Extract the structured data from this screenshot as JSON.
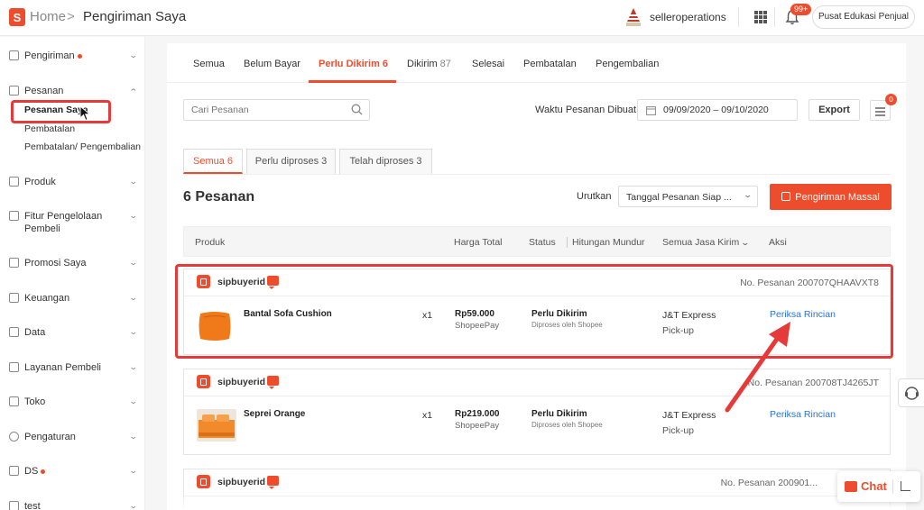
{
  "header": {
    "logo_letter": "S",
    "home_label": "Home",
    "separator": ">",
    "page_title": "Pengiriman Saya",
    "username": "selleroperations",
    "notification_badge": "99+",
    "edu_button": "Pusat Edukasi Penjual"
  },
  "sidebar": {
    "items": [
      {
        "label": "Pengiriman",
        "icon": "truck-icon",
        "dot": true
      },
      {
        "label": "Pesanan",
        "icon": "clipboard-icon",
        "expanded": true
      },
      {
        "label": "Produk",
        "icon": "box-icon"
      },
      {
        "label": "Fitur Pengelolaan Pembeli",
        "icon": "users-icon"
      },
      {
        "label": "Promosi Saya",
        "icon": "tag-icon"
      },
      {
        "label": "Keuangan",
        "icon": "wallet-icon"
      },
      {
        "label": "Data",
        "icon": "chart-icon"
      },
      {
        "label": "Layanan Pembeli",
        "icon": "headset-icon"
      },
      {
        "label": "Toko",
        "icon": "store-icon"
      },
      {
        "label": "Pengaturan",
        "icon": "gear-icon"
      },
      {
        "label": "DS",
        "icon": "ds-icon",
        "dot": true
      },
      {
        "label": "test",
        "icon": "test-icon"
      }
    ],
    "sub_items": [
      "Pesanan Saya",
      "Pembatalan",
      "Pembatalan/ Pengembalian"
    ]
  },
  "tabs": [
    {
      "label": "Semua",
      "count": ""
    },
    {
      "label": "Belum Bayar",
      "count": ""
    },
    {
      "label": "Perlu Dikirim",
      "count": "6",
      "active": true
    },
    {
      "label": "Dikirim",
      "count": "87"
    },
    {
      "label": "Selesai",
      "count": ""
    },
    {
      "label": "Pembatalan",
      "count": ""
    },
    {
      "label": "Pengembalian",
      "count": ""
    }
  ],
  "filters": {
    "search_placeholder": "Cari Pesanan",
    "date_label": "Waktu Pesanan Dibuat",
    "date_range": "09/09/2020 – 09/10/2020",
    "export_label": "Export",
    "list_badge": "0"
  },
  "subtabs": [
    {
      "label": "Semua 6",
      "active": true
    },
    {
      "label": "Perlu diproses 3"
    },
    {
      "label": "Telah diproses 3"
    }
  ],
  "summary": {
    "count_title": "6 Pesanan",
    "sort_label": "Urutkan",
    "sort_value": "Tanggal Pesanan Siap ...",
    "mass_ship_label": "Pengiriman Massal"
  },
  "table_header": {
    "produk": "Produk",
    "harga": "Harga Total",
    "status": "Status",
    "countdown": "Hitungan Mundur",
    "courier": "Semua Jasa Kirim",
    "aksi": "Aksi"
  },
  "orders": [
    {
      "buyer": "sipbuyerid",
      "order_no": "No. Pesanan 200707QHAAVXT8",
      "product": "Bantal Sofa Cushion",
      "qty": "x1",
      "price": "Rp59.000",
      "payment": "ShopeePay",
      "status": "Perlu Dikirim",
      "status_sub": "Diproses oleh Shopee",
      "courier": "J&T Express",
      "pickup": "Pick-up",
      "action": "Periksa Rincian"
    },
    {
      "buyer": "sipbuyerid",
      "order_no": "No. Pesanan 200708TJ4265JT",
      "product": "Seprei Orange",
      "qty": "x1",
      "price": "Rp219.000",
      "payment": "ShopeePay",
      "status": "Perlu Dikirim",
      "status_sub": "Diproses oleh Shopee",
      "courier": "J&T Express",
      "pickup": "Pick-up",
      "action": "Periksa Rincian"
    },
    {
      "buyer": "sipbuyerid",
      "order_no": "No. Pesanan 200901..."
    }
  ],
  "chat_widget": {
    "label": "Chat"
  },
  "colors": {
    "brand": "#ee4d2d",
    "link": "#2673dd",
    "highlight": "#e63a3a"
  }
}
